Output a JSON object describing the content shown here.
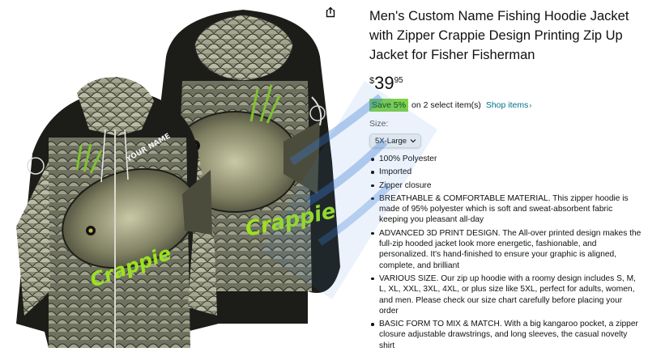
{
  "product": {
    "title": "Men's Custom Name Fishing Hoodie Jacket with Zipper Crappie Design Printing Zip Up Jacket for Fisher Fisherman",
    "price": {
      "symbol": "$",
      "whole": "39",
      "fraction": "95"
    },
    "promo": {
      "badge": "Save 5%",
      "text": "on 2 select item(s)",
      "link": "Shop items",
      "link_icon": "chevron-right-icon"
    },
    "size": {
      "label": "Size:",
      "selected": "5X-Large"
    },
    "image": {
      "print_name": "YOUR NAME",
      "print_text": "Crappie",
      "share_icon": "share-icon"
    },
    "bullets": [
      "100% Polyester",
      "Imported",
      "Zipper closure",
      "BREATHABLE & COMFORTABLE MATERIAL. This zipper hoodie is made of 95% polyester which is soft and sweat-absorbent fabric keeping you pleasant all-day",
      "ADVANCED 3D PRINT DESIGN. The All-over printed design makes the full-zip hooded jacket look more energetic, fashionable, and personalized. It's hand-finished to ensure your graphic is aligned, complete, and brilliant",
      "VARIOUS SIZE. Our zip up hoodie with a roomy design includes S, M, L, XL, XXL, 3XL, 4XL, or plus size like 5XL, perfect for adults, women, and men. Please check our size chart carefully before placing your order",
      "BASIC FORM TO MIX & MATCH. With a big kangaroo pocket, a zipper closure adjustable drawstrings, and long sleeves, the casual novelty shirt"
    ]
  },
  "colors": {
    "link": "#007185",
    "save_badge": "#7fd24a",
    "text": "#0f1111",
    "watermark": "#3a7bd5"
  }
}
